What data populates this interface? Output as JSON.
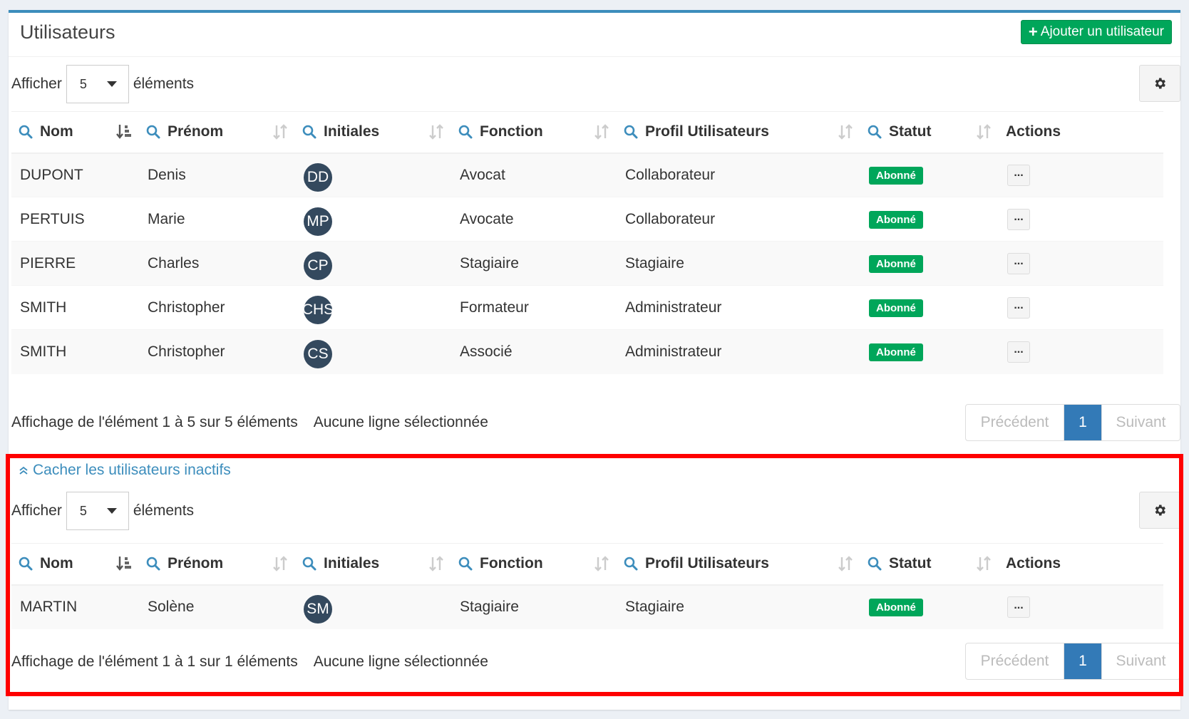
{
  "header": {
    "title": "Utilisateurs",
    "add_button_label": "Ajouter un utilisateur"
  },
  "icons": {
    "search": "search-icon",
    "sort_active": "sort-alpha-asc-icon",
    "sort": "sort-icon",
    "gear": "gear-icon",
    "plus": "plus-icon",
    "dots": "ellipsis-icon",
    "chevrons_up": "double-chevron-up-icon"
  },
  "colors": {
    "accent": "#3c8dbc",
    "success": "#00a65a",
    "primary": "#337ab7",
    "avatar": "#34495e",
    "highlight": "#ff0000"
  },
  "columns": {
    "nom": "Nom",
    "prenom": "Prénom",
    "initiales": "Initiales",
    "fonction": "Fonction",
    "profil": "Profil Utilisateurs",
    "statut": "Statut",
    "actions": "Actions"
  },
  "active": {
    "length": {
      "prefix": "Afficher",
      "value": "5",
      "suffix": "éléments"
    },
    "rows": [
      {
        "nom": "DUPONT",
        "prenom": "Denis",
        "initiales": "DD",
        "fonction": "Avocat",
        "profil": "Collaborateur",
        "statut": "Abonné"
      },
      {
        "nom": "PERTUIS",
        "prenom": "Marie",
        "initiales": "MP",
        "fonction": "Avocate",
        "profil": "Collaborateur",
        "statut": "Abonné"
      },
      {
        "nom": "PIERRE",
        "prenom": "Charles",
        "initiales": "CP",
        "fonction": "Stagiaire",
        "profil": "Stagiaire",
        "statut": "Abonné"
      },
      {
        "nom": "SMITH",
        "prenom": "Christopher",
        "initiales": "CHS",
        "fonction": "Formateur",
        "profil": "Administrateur",
        "statut": "Abonné"
      },
      {
        "nom": "SMITH",
        "prenom": "Christopher",
        "initiales": "CS",
        "fonction": "Associé",
        "profil": "Administrateur",
        "statut": "Abonné"
      }
    ],
    "info": "Affichage de l'élément 1 à 5 sur 5 éléments",
    "selection": "Aucune ligne sélectionnée",
    "pagination": {
      "prev": "Précédent",
      "current": "1",
      "next": "Suivant"
    }
  },
  "inactive": {
    "toggle_label": "Cacher les utilisateurs inactifs",
    "length": {
      "prefix": "Afficher",
      "value": "5",
      "suffix": "éléments"
    },
    "rows": [
      {
        "nom": "MARTIN",
        "prenom": "Solène",
        "initiales": "SM",
        "fonction": "Stagiaire",
        "profil": "Stagiaire",
        "statut": "Abonné"
      }
    ],
    "info": "Affichage de l'élément 1 à 1 sur 1 éléments",
    "selection": "Aucune ligne sélectionnée",
    "pagination": {
      "prev": "Précédent",
      "current": "1",
      "next": "Suivant"
    }
  }
}
